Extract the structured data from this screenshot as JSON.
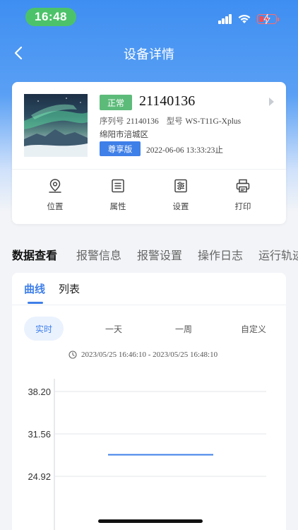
{
  "status_bar": {
    "time": "16:48"
  },
  "nav": {
    "title": "设备详情"
  },
  "device": {
    "status": "正常",
    "id": "21140136",
    "serial_label": "序列号",
    "serial_value": "21140136",
    "model_label": "型号",
    "model_value": "WS-T11G-Xplus",
    "location": "绵阳市涪城区",
    "edition": "尊享版",
    "expire_value": "2022-06-06 13:33:23",
    "expire_suffix": "止"
  },
  "actions": [
    {
      "label": "位置",
      "icon": "location-icon"
    },
    {
      "label": "属性",
      "icon": "properties-icon"
    },
    {
      "label": "设置",
      "icon": "settings-icon"
    },
    {
      "label": "打印",
      "icon": "printer-icon"
    }
  ],
  "main_tabs": [
    "数据查看",
    "报警信息",
    "报警设置",
    "操作日志",
    "运行轨迹"
  ],
  "sub_tabs": [
    "曲线",
    "列表"
  ],
  "ranges": [
    "实时",
    "一天",
    "一周",
    "自定义"
  ],
  "time_range": {
    "value": "2023/05/25 16:46:10 - 2023/05/25 16:48:10"
  },
  "colors": {
    "accent": "#3f7fe8",
    "status_green": "#5dbb7a",
    "time_pill": "#4cc36a"
  },
  "chart_data": {
    "type": "line",
    "y_ticks": [
      "38.20",
      "31.56",
      "24.92"
    ],
    "ylim": [
      18.28,
      38.2
    ],
    "x": [
      "16:46:10",
      "16:48:10"
    ],
    "series": [
      {
        "values": [
          28.3,
          28.3
        ]
      }
    ],
    "grid": true
  }
}
